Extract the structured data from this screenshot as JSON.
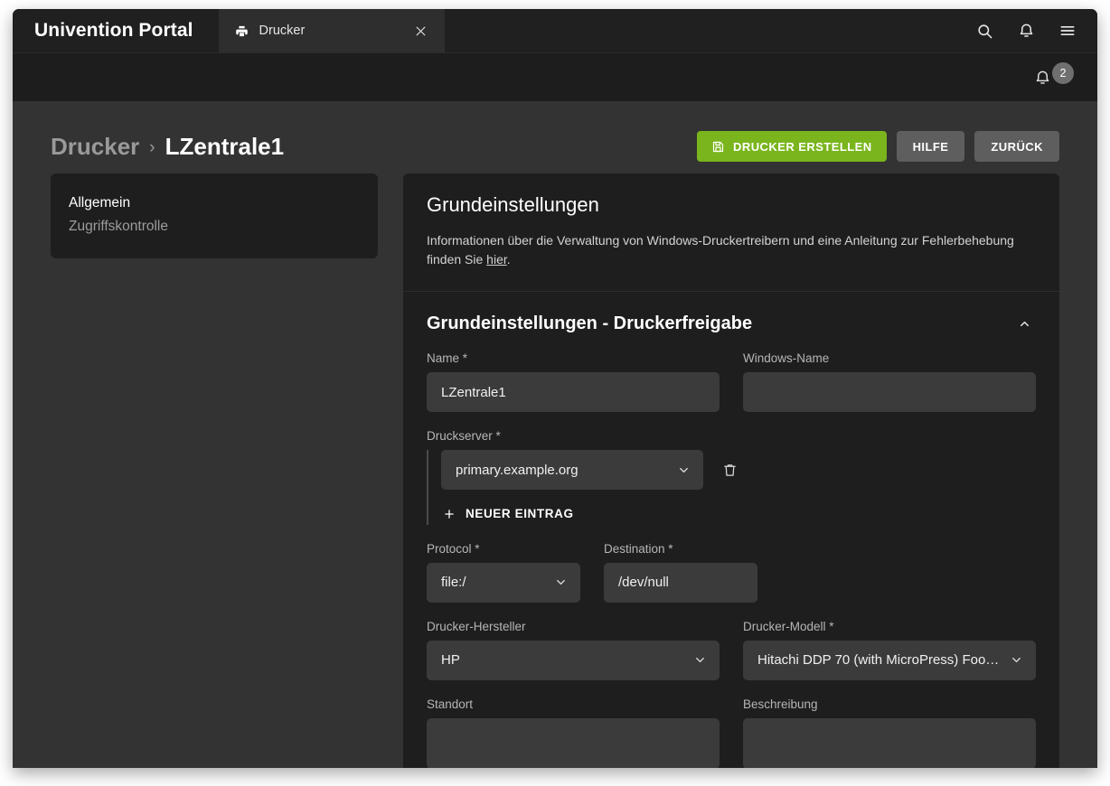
{
  "browser": {
    "brand": "Univention Portal",
    "tab": {
      "label": "Drucker",
      "icon": "printer-icon",
      "close_icon": "close-icon"
    },
    "actions": [
      {
        "name": "search-icon",
        "label": "Suche"
      },
      {
        "name": "bell-icon",
        "label": "Benachrichtigungen"
      },
      {
        "name": "menu-icon",
        "label": "Menü"
      }
    ]
  },
  "subheader": {
    "notification_icon": "bell-icon",
    "notification_count": "2"
  },
  "breadcrumb": {
    "parent": "Drucker",
    "separator": "›",
    "current": "LZentrale1"
  },
  "toolbar": {
    "create_label": "DRUCKER ERSTELLEN",
    "create_icon": "save-icon",
    "help_label": "HILFE",
    "back_label": "ZURÜCK"
  },
  "sidebar": {
    "items": [
      {
        "label": "Allgemein",
        "active": true
      },
      {
        "label": "Zugriffskontrolle",
        "active": false
      }
    ]
  },
  "panel": {
    "title": "Grundeinstellungen",
    "description_before": "Informationen über die Verwaltung von Windows-Druckertreibern und eine Anleitung zur Fehlerbehebung finden Sie ",
    "description_link": "hier",
    "description_after": "."
  },
  "section": {
    "title": "Grundeinstellungen - Druckerfreigabe",
    "toggle_icon": "chevron-up-icon",
    "fields": {
      "name": {
        "label": "Name *",
        "value": "LZentrale1",
        "placeholder": ""
      },
      "windows_name": {
        "label": "Windows-Name",
        "value": "",
        "placeholder": ""
      },
      "druckserver": {
        "label": "Druckserver *",
        "value": "primary.example.org",
        "delete_icon": "trash-icon",
        "add_label": "NEUER EINTRAG",
        "add_icon": "plus-icon"
      },
      "protocol": {
        "label": "Protocol *",
        "value": "file:/"
      },
      "destination": {
        "label": "Destination *",
        "value": "/dev/null",
        "placeholder": ""
      },
      "hersteller": {
        "label": "Drucker-Hersteller",
        "value": "HP"
      },
      "modell": {
        "label": "Drucker-Modell *",
        "value": "Hitachi DDP 70 (with MicroPress) Foo…"
      },
      "standort": {
        "label": "Standort",
        "value": "",
        "placeholder": ""
      },
      "beschreibung": {
        "label": "Beschreibung",
        "value": "",
        "placeholder": ""
      }
    }
  },
  "colors": {
    "accent_green": "#7ab51d",
    "page_bg": "#333333",
    "panel_bg": "#1e1e1e",
    "input_bg": "#3b3b3b",
    "chrome_bg": "#202020"
  }
}
